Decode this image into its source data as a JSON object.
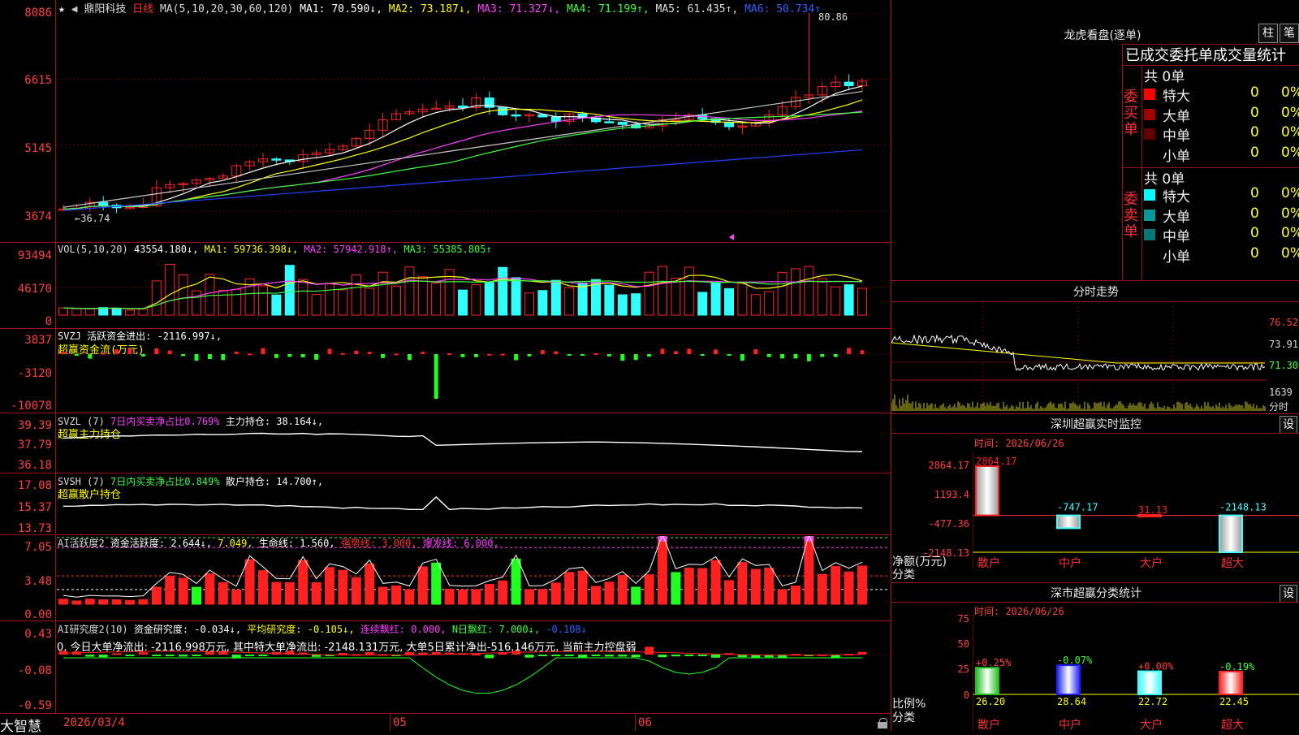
{
  "app": {
    "brand": "大智慧"
  },
  "header": {
    "star": "★",
    "nav_left": "◀",
    "stock": "鼎阳科技",
    "period": "日线",
    "ma_label": "MA(5,10,20,30,60,120)",
    "mas": [
      {
        "text": "MA1: 70.590↓,",
        "color": "#ffffff"
      },
      {
        "text": "MA2: 73.187↓,",
        "color": "#ffff00"
      },
      {
        "text": "MA3: 71.327↓,",
        "color": "#ff40ff"
      },
      {
        "text": "MA4: 71.199↑,",
        "color": "#40ff40"
      },
      {
        "text": "MA5: 61.435↑,",
        "color": "#c8c8c8"
      },
      {
        "text": "MA6: 50.734↑",
        "color": "#3050ff"
      }
    ]
  },
  "price_axis": {
    "ticks": [
      "8086",
      "6615",
      "5145",
      "3674"
    ]
  },
  "price_annotations": {
    "high": "80.86",
    "low": "←36.74"
  },
  "vol": {
    "axis": [
      "93494",
      "46170",
      "0"
    ],
    "label": "VOL(5,10,20)",
    "parts": [
      {
        "text": "43554.180↓,",
        "color": "#ffffff"
      },
      {
        "text": "MA1: 59736.398↓,",
        "color": "#ffff00"
      },
      {
        "text": "MA2: 57942.918↑,",
        "color": "#ff40ff"
      },
      {
        "text": "MA3: 55385.805↑",
        "color": "#40ff40"
      }
    ]
  },
  "svzj": {
    "axis": [
      "3837",
      "-3120",
      "-10078"
    ],
    "line1": "SVZJ  活跃资金进出: -2116.997↓,",
    "line2": "超赢资金流(万元)"
  },
  "svzl": {
    "axis": [
      "39.39",
      "37.79",
      "36.18"
    ],
    "title": "SVZL (7)",
    "net": "7日内买卖净占比0.769%",
    "hold": "主力持仓: 38.164↓,",
    "line2": "超赢主力持仓"
  },
  "svsh": {
    "axis": [
      "17.08",
      "15.37",
      "13.73"
    ],
    "title": "SVSH (7)",
    "net": "7日内买卖净占比0.849%",
    "hold": "散户持仓: 14.700↑,",
    "line2": "超赢散户持仓"
  },
  "ai_active": {
    "axis": [
      "7.05",
      "3.48",
      "0.00"
    ],
    "title": "AI活跃度2",
    "p1": "资金活跃度: 2.644↓,",
    "p2": "7.049,",
    "p3": "生命线: 1.560,",
    "p4": "强势线: 3.000,",
    "p5": "爆发线: 6.000,"
  },
  "ai_research": {
    "axis": [
      "0.43",
      "-0.08",
      "-0.59"
    ],
    "title": "AI研究度2(10)",
    "p1": "资金研究度: -0.034↓,",
    "p2": "平均研究度: -0.105↓,",
    "p3": "连续飘红: 0.000,",
    "p4": "N日飘红: 7.000↓,",
    "p5": "-0.108↓",
    "line2": "0, 今日大单净流出: -2116.998万元, 其中特大单净流出: -2148.131万元, 大单5日累计净出-516.146万元, 当前主力控盘弱"
  },
  "date_axis": [
    "2026/03/4",
    "05",
    "06"
  ],
  "lhb": {
    "title": "龙虎看盘(逐单)",
    "btn1": "柱",
    "btn2": "笔",
    "subtitle": "已成交委托单成交量统计",
    "buy_label": "委买单",
    "sell_label": "委卖单",
    "buy_total": "共 0单",
    "sell_total": "共 0单",
    "buy_rows": [
      {
        "name": "特大",
        "count": "0",
        "pct": "0%",
        "color": "#ff0000"
      },
      {
        "name": "大单",
        "count": "0",
        "pct": "0%",
        "color": "#a00000"
      },
      {
        "name": "中单",
        "count": "0",
        "pct": "0%",
        "color": "#600000"
      },
      {
        "name": "小单",
        "count": "0",
        "pct": "0%",
        "color": ""
      }
    ],
    "sell_rows": [
      {
        "name": "特大",
        "count": "0",
        "pct": "0%",
        "color": "#00ffff"
      },
      {
        "name": "大单",
        "count": "0",
        "pct": "0%",
        "color": "#009a9a"
      },
      {
        "name": "中单",
        "count": "0",
        "pct": "0%",
        "color": "#007878"
      },
      {
        "name": "小单",
        "count": "0",
        "pct": "0%",
        "color": ""
      }
    ]
  },
  "intraday": {
    "title": "分时走势",
    "ticks": [
      "76.52",
      "73.91",
      "71.30",
      "1639"
    ],
    "unit": "分时"
  },
  "sz_monitor": {
    "title": "深圳超赢实时监控",
    "btn": "设",
    "time": "时间: 2026/06/26",
    "axis": [
      "2864.17",
      "1193.4",
      "-477.36",
      "-2148.13"
    ],
    "ylabel1": "净额(万元)",
    "ylabel2": "分类",
    "bars": [
      {
        "cat": "散户",
        "value": 2864.17,
        "label": "2864.17",
        "color": "#ff2020"
      },
      {
        "cat": "中户",
        "value": -747.17,
        "label": "-747.17",
        "color": "#40ffff"
      },
      {
        "cat": "大户",
        "value": 31.13,
        "label": "31.13",
        "color": "#ff2020"
      },
      {
        "cat": "超大",
        "value": -2148.13,
        "label": "-2148.13",
        "color": "#40ffff"
      }
    ]
  },
  "sz_stats": {
    "title": "深市超赢分类统计",
    "btn": "设",
    "time": "时间: 2026/06/26",
    "axis": [
      "75",
      "50",
      "25",
      "0"
    ],
    "ylabel1": "比例%",
    "ylabel2": "分类",
    "bars": [
      {
        "cat": "散户",
        "value": 26.2,
        "label": "26.20",
        "change": "+0.25%",
        "change_color": "#ff4040",
        "fill": "#20c020"
      },
      {
        "cat": "中户",
        "value": 28.64,
        "label": "28.64",
        "change": "-0.07%",
        "change_color": "#40ff40",
        "fill": "#2020ff"
      },
      {
        "cat": "大户",
        "value": 22.72,
        "label": "22.72",
        "change": "+0.00%",
        "change_color": "#ff4040",
        "fill": "#40ffff"
      },
      {
        "cat": "超大",
        "value": 22.45,
        "label": "22.45",
        "change": "-0.19%",
        "change_color": "#40ff40",
        "fill": "#ff2020"
      }
    ]
  }
}
